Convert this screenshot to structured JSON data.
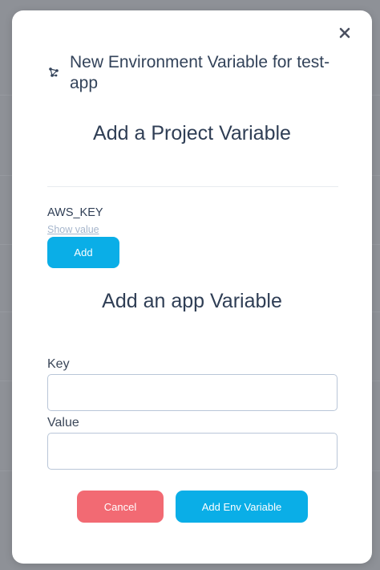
{
  "modal": {
    "title": "New Environment Variable for test-app",
    "close_icon": "close-icon",
    "header_icon": "connection-nodes-icon"
  },
  "project_section": {
    "heading": "Add a Project Variable",
    "variable_key": "AWS_KEY",
    "show_value_label": "Show value",
    "add_label": "Add"
  },
  "app_section": {
    "heading": "Add an app Variable",
    "key_label": "Key",
    "key_value": "",
    "value_label": "Value",
    "value_value": ""
  },
  "footer": {
    "cancel_label": "Cancel",
    "submit_label": "Add Env Variable"
  },
  "colors": {
    "primary": "#0aaee7",
    "danger": "#f26a73",
    "heading_text": "#2f3e55",
    "overlay": "#8e9197"
  }
}
